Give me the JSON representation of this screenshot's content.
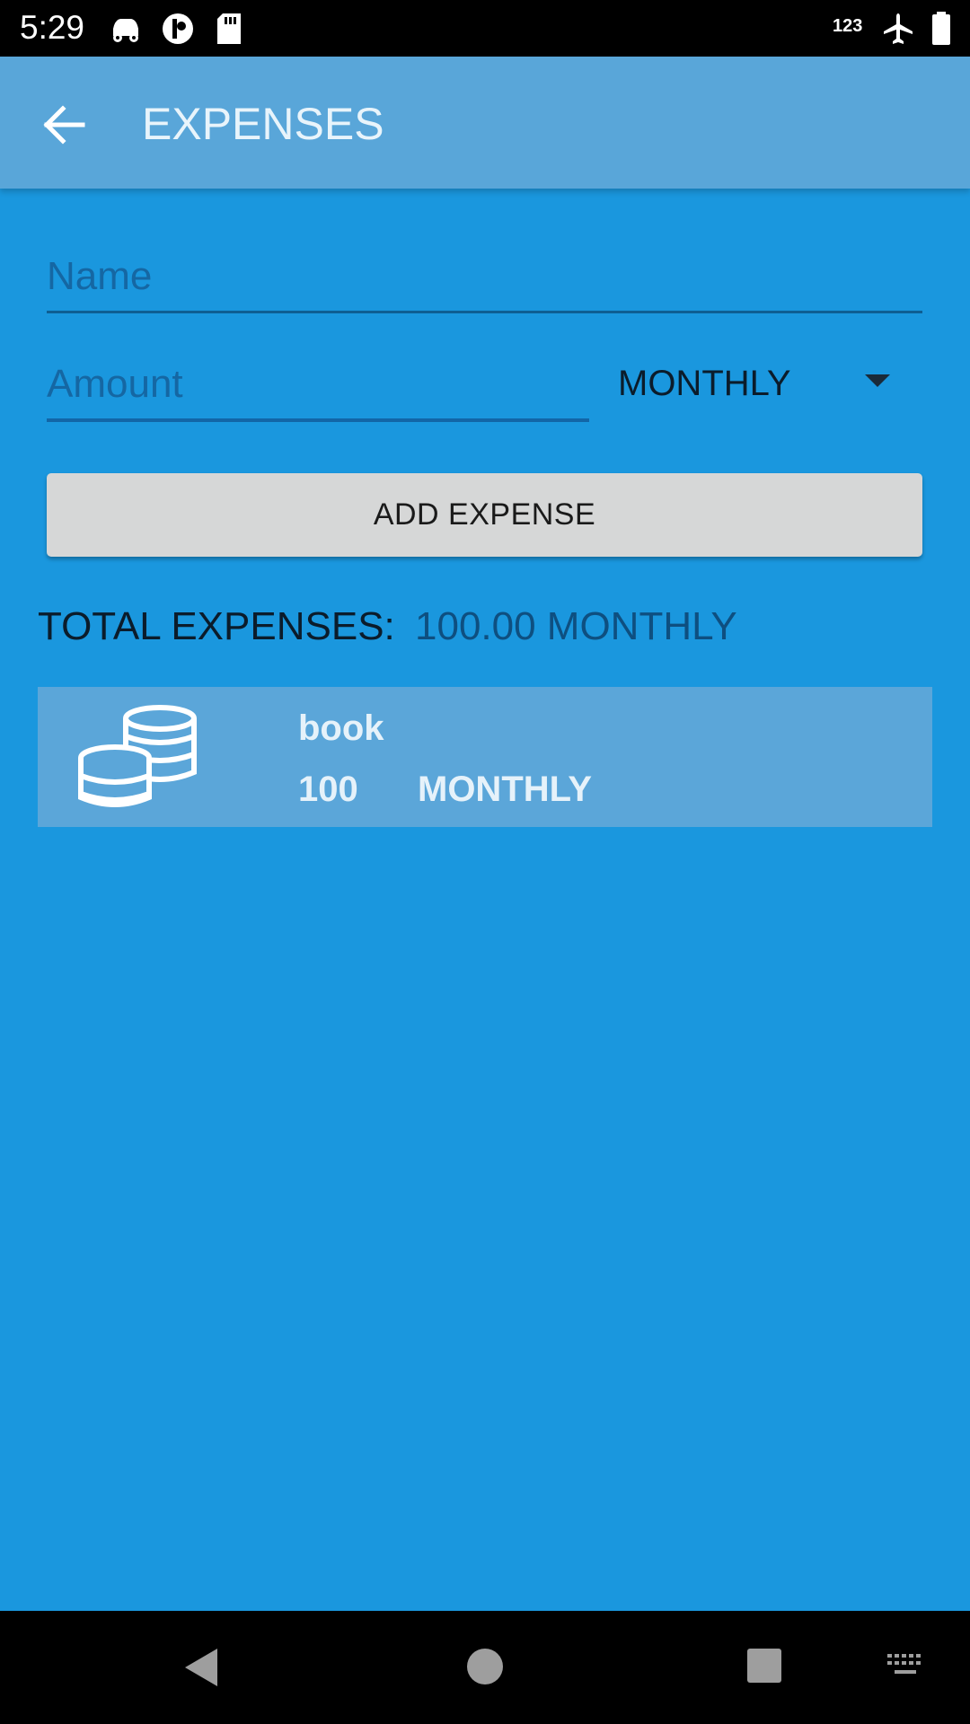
{
  "status_bar": {
    "time": "5:29",
    "signal_label": "123",
    "icons": [
      "car-icon",
      "app-indicator-icon",
      "sd-card-icon",
      "airplane-icon",
      "battery-icon"
    ]
  },
  "app_bar": {
    "title": "EXPENSES",
    "back_icon": "arrow-back-icon"
  },
  "form": {
    "name_placeholder": "Name",
    "name_value": "",
    "amount_placeholder": "Amount",
    "amount_value": "",
    "period_selected": "MONTHLY",
    "add_button_label": "ADD EXPENSE"
  },
  "summary": {
    "total_label": "TOTAL EXPENSES:",
    "total_value": "100.00 MONTHLY"
  },
  "expenses": [
    {
      "name": "book",
      "amount": "100",
      "period": "MONTHLY",
      "icon": "coins-icon"
    }
  ],
  "nav_bar": {
    "icons": [
      "back-triangle-icon",
      "home-circle-icon",
      "recents-square-icon",
      "keyboard-icon"
    ]
  },
  "colors": {
    "background": "#1a97de",
    "app_bar": "#59a6d9",
    "list_item": "#5ba6d9",
    "button": "#d6d7d7",
    "underline": "#0e5f93"
  }
}
